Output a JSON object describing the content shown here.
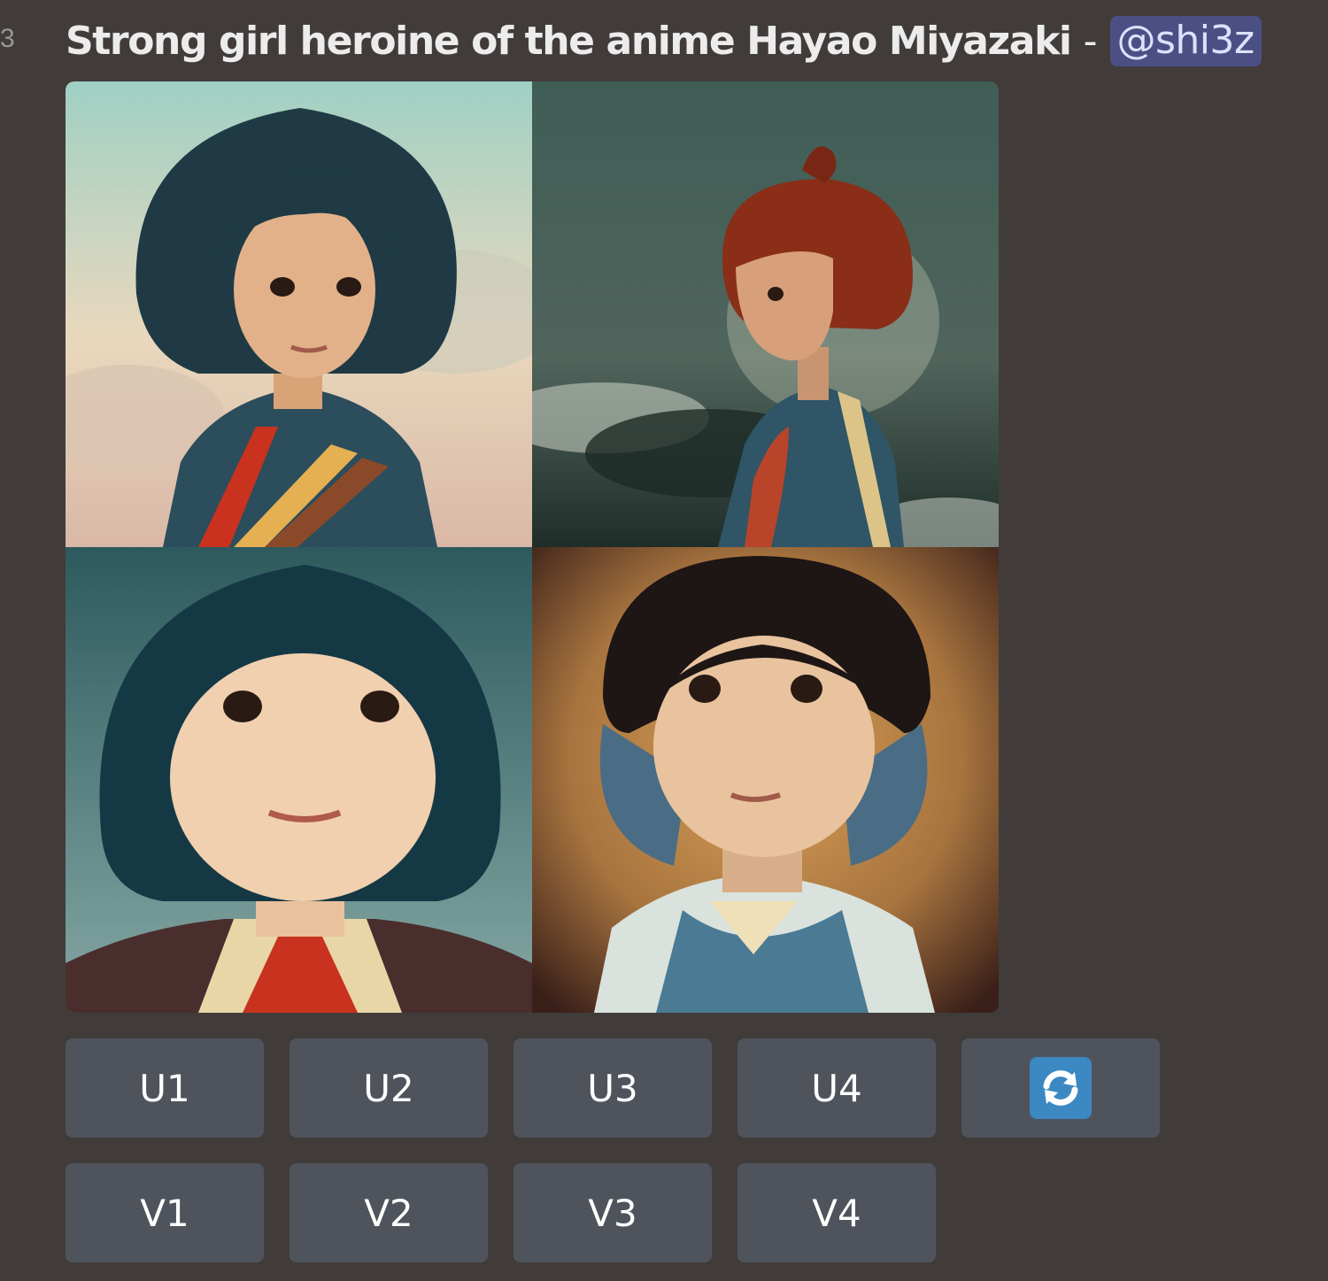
{
  "message": {
    "line_marker": "3",
    "prompt": "Strong girl heroine of the anime Hayao Miyazaki",
    "separator": "-",
    "mention": "@shi3z"
  },
  "image_grid": {
    "tiles": [
      {
        "label": "image-1",
        "hair": "#1f3a44",
        "bg_top": "#9fcfc3",
        "bg_bottom": "#e6cfb4",
        "outfit": "#2b4d5c"
      },
      {
        "label": "image-2",
        "hair": "#8a2e17",
        "bg_top": "#3c5c54",
        "bg_bottom": "#1f2f2b",
        "outfit": "#2f5566"
      },
      {
        "label": "image-3",
        "hair": "#153845",
        "bg_top": "#2d5a5e",
        "bg_bottom": "#7fa3a0",
        "outfit": "#e8d6a6"
      },
      {
        "label": "image-4",
        "hair": "#1d1614",
        "bg_top": "#b88447",
        "bg_bottom": "#4a2a1d",
        "outfit": "#4a7a94"
      }
    ]
  },
  "buttons": {
    "upscale": [
      "U1",
      "U2",
      "U3",
      "U4"
    ],
    "variation": [
      "V1",
      "V2",
      "V3",
      "V4"
    ],
    "reroll_icon": "refresh-icon"
  },
  "colors": {
    "background": "#413c3a",
    "button": "#4f545c",
    "mention_bg": "#4b4f84",
    "mention_text": "#dee0fc",
    "reroll_blue": "#3b88c3"
  }
}
